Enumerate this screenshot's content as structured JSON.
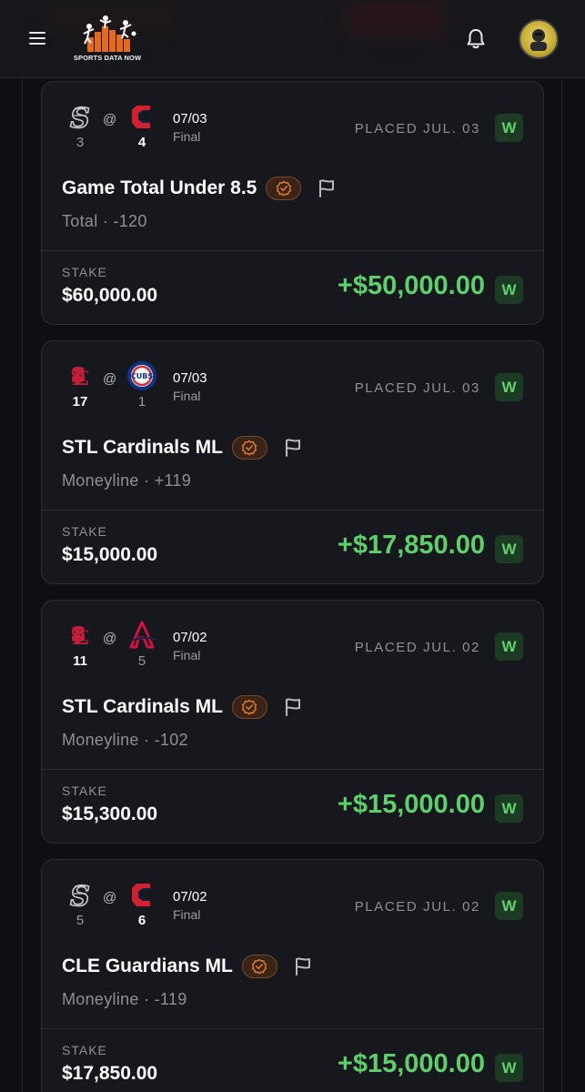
{
  "header": {
    "logo_text": "SPORTS DATA NOW",
    "logo_icon": "sports-data-now-logo",
    "menu_icon": "hamburger-menu-icon",
    "notification_icon": "bell-icon",
    "avatar_icon": "user-avatar"
  },
  "colors": {
    "win_green": "#5fcf6c",
    "badge_bg": "#1c3a24",
    "card_bg": "#16181d",
    "verified_orange": "#e07a2e"
  },
  "bets": [
    {
      "away": {
        "team": "CHW",
        "logo": "white-sox-logo",
        "score": "3",
        "winner": false
      },
      "at": "@",
      "home": {
        "team": "CLE",
        "logo": "guardians-logo",
        "score": "4",
        "winner": true
      },
      "date": "07/03",
      "status": "Final",
      "placed": "PLACED JUL. 03",
      "result": "W",
      "pick": "Game Total Under 8.5",
      "market": "Total  ·  -120",
      "stake_label": "STAKE",
      "stake": "$60,000.00",
      "payout": "+$50,000.00"
    },
    {
      "away": {
        "team": "STL",
        "logo": "cardinals-logo",
        "score": "17",
        "winner": true
      },
      "at": "@",
      "home": {
        "team": "CHC",
        "logo": "cubs-logo",
        "score": "1",
        "winner": false
      },
      "date": "07/03",
      "status": "Final",
      "placed": "PLACED JUL. 03",
      "result": "W",
      "pick": "STL Cardinals ML",
      "market": "Moneyline  ·  +119",
      "stake_label": "STAKE",
      "stake": "$15,000.00",
      "payout": "+$17,850.00"
    },
    {
      "away": {
        "team": "STL",
        "logo": "cardinals-logo",
        "score": "11",
        "winner": true
      },
      "at": "@",
      "home": {
        "team": "ATL",
        "logo": "braves-logo",
        "score": "5",
        "winner": false
      },
      "date": "07/02",
      "status": "Final",
      "placed": "PLACED JUL. 02",
      "result": "W",
      "pick": "STL Cardinals ML",
      "market": "Moneyline  ·  -102",
      "stake_label": "STAKE",
      "stake": "$15,300.00",
      "payout": "+$15,000.00"
    },
    {
      "away": {
        "team": "CHW",
        "logo": "white-sox-logo",
        "score": "5",
        "winner": false
      },
      "at": "@",
      "home": {
        "team": "CLE",
        "logo": "guardians-logo",
        "score": "6",
        "winner": true
      },
      "date": "07/02",
      "status": "Final",
      "placed": "PLACED JUL. 02",
      "result": "W",
      "pick": "CLE Guardians ML",
      "market": "Moneyline  ·  -119",
      "stake_label": "STAKE",
      "stake": "$17,850.00",
      "payout": "+$15,000.00"
    }
  ]
}
